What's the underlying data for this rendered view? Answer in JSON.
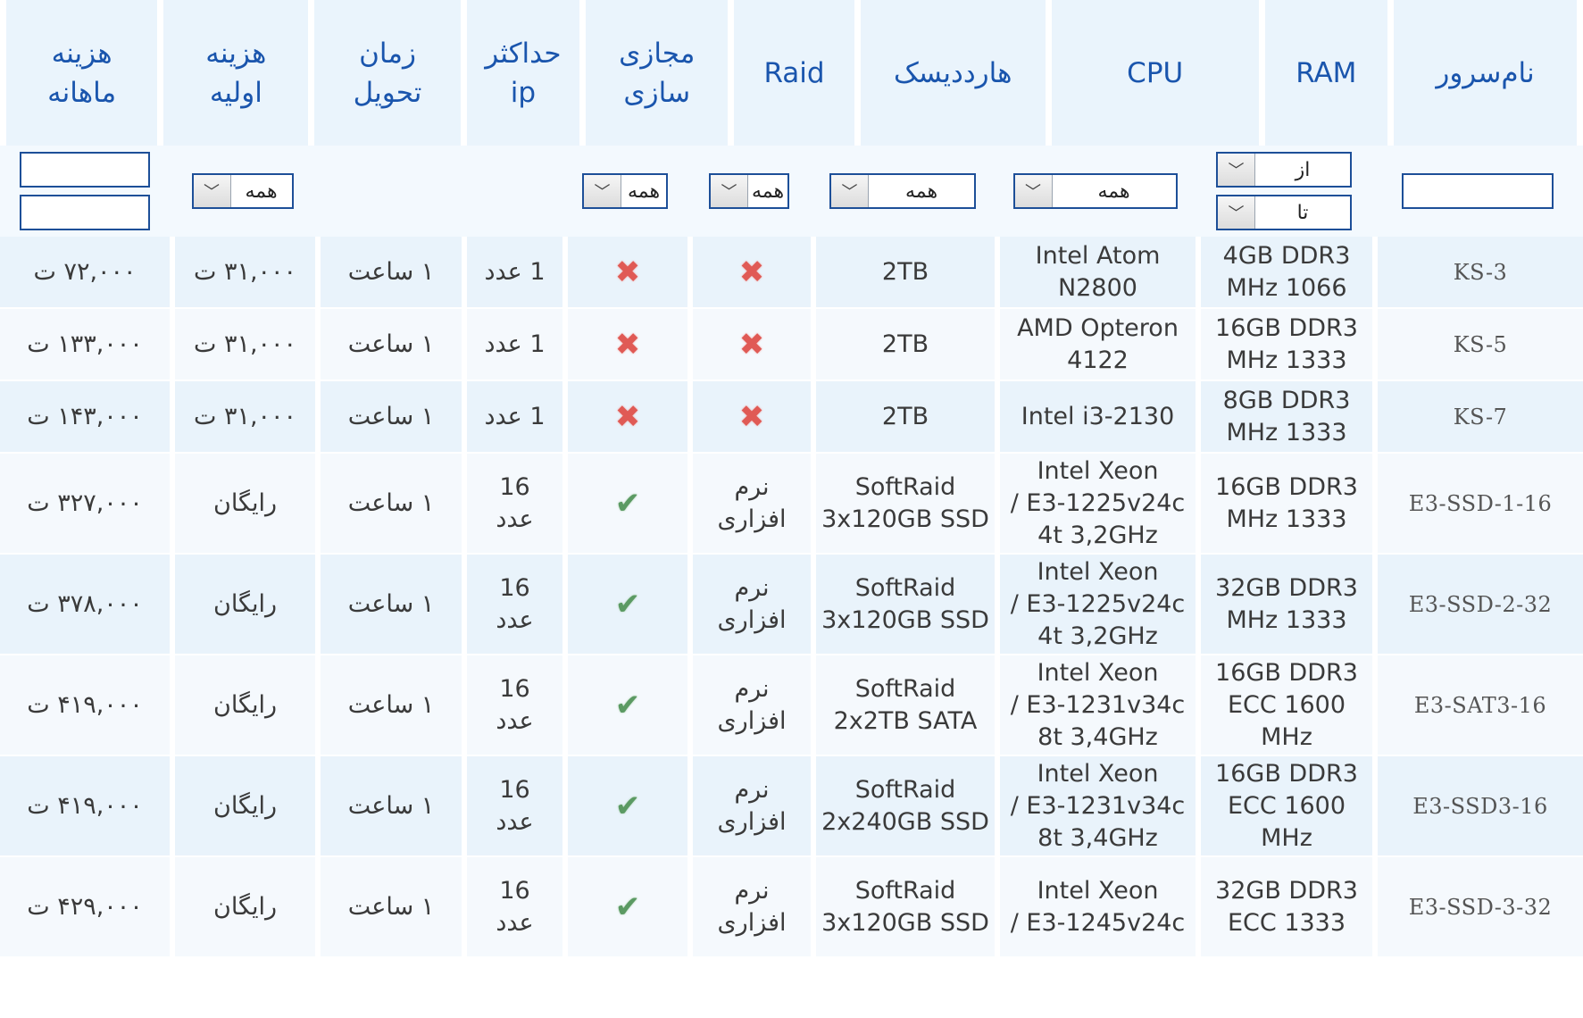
{
  "headers": {
    "name": "نام‌سرور",
    "ram": "RAM",
    "cpu": "CPU",
    "hdd": "هارددیسک",
    "raid": "Raid",
    "virt_1": "مجازی",
    "virt_2": "سازی",
    "ip_1": "حداکثر",
    "ip_2": "ip",
    "delivery_1": "زمان",
    "delivery_2": "تحویل",
    "setup_1": "هزینه",
    "setup_2": "اولیه",
    "monthly_1": "هزینه",
    "monthly_2": "ماهانه"
  },
  "filters": {
    "name_value": "",
    "ram_from": "از",
    "ram_to": "تا",
    "cpu": "همه",
    "hdd": "همه",
    "raid": "همه",
    "virt": "همه",
    "setup": "همه",
    "monthly_min": "",
    "monthly_max": ""
  },
  "icons": {
    "x": "✖",
    "check": "✔",
    "dropdown": "﹀"
  },
  "rows": [
    {
      "name": "KS-3",
      "ram": [
        "4GB DDR3",
        "1066 MHz"
      ],
      "cpu": [
        "Intel Atom",
        "N2800"
      ],
      "hdd": [
        "2TB"
      ],
      "raid": null,
      "virt": false,
      "ip": [
        "1 عدد"
      ],
      "delivery": "۱ ساعت",
      "setup": "۳۱,۰۰۰ ت",
      "monthly": "۷۲,۰۰۰ ت"
    },
    {
      "name": "KS-5",
      "ram": [
        "16GB DDR3",
        "1333 MHz"
      ],
      "cpu": [
        "AMD Opteron",
        "4122"
      ],
      "hdd": [
        "2TB"
      ],
      "raid": null,
      "virt": false,
      "ip": [
        "1 عدد"
      ],
      "delivery": "۱ ساعت",
      "setup": "۳۱,۰۰۰ ت",
      "monthly": "۱۳۳,۰۰۰ ت"
    },
    {
      "name": "KS-7",
      "ram": [
        "8GB DDR3",
        "1333 MHz"
      ],
      "cpu": [
        "Intel i3-2130"
      ],
      "hdd": [
        "2TB"
      ],
      "raid": null,
      "virt": false,
      "ip": [
        "1 عدد"
      ],
      "delivery": "۱ ساعت",
      "setup": "۳۱,۰۰۰ ت",
      "monthly": "۱۴۳,۰۰۰ ت"
    },
    {
      "name": "E3-SSD-1-16",
      "ram": [
        "16GB DDR3",
        "1333 MHz"
      ],
      "cpu": [
        "Intel Xeon",
        "E3-1225v24c /",
        "4t 3,2GHz"
      ],
      "hdd": [
        "SoftRaid",
        "3x120GB SSD"
      ],
      "raid": [
        "نرم",
        "افزاری"
      ],
      "virt": true,
      "ip": [
        "16",
        "عدد"
      ],
      "delivery": "۱ ساعت",
      "setup": "رایگان",
      "monthly": "۳۲۷,۰۰۰ ت"
    },
    {
      "name": "E3-SSD-2-32",
      "ram": [
        "32GB DDR3",
        "1333 MHz"
      ],
      "cpu": [
        "Intel Xeon",
        "E3-1225v24c /",
        "4t 3,2GHz"
      ],
      "hdd": [
        "SoftRaid",
        "3x120GB SSD"
      ],
      "raid": [
        "نرم",
        "افزاری"
      ],
      "virt": true,
      "ip": [
        "16",
        "عدد"
      ],
      "delivery": "۱ ساعت",
      "setup": "رایگان",
      "monthly": "۳۷۸,۰۰۰ ت"
    },
    {
      "name": "E3-SAT3-16",
      "ram": [
        "16GB DDR3",
        "ECC 1600",
        "MHz"
      ],
      "cpu": [
        "Intel Xeon",
        "E3-1231v34c /",
        "8t 3,4GHz"
      ],
      "hdd": [
        "SoftRaid",
        "2x2TB SATA"
      ],
      "raid": [
        "نرم",
        "افزاری"
      ],
      "virt": true,
      "ip": [
        "16",
        "عدد"
      ],
      "delivery": "۱ ساعت",
      "setup": "رایگان",
      "monthly": "۴۱۹,۰۰۰ ت"
    },
    {
      "name": "E3-SSD3-16",
      "ram": [
        "16GB DDR3",
        "ECC 1600",
        "MHz"
      ],
      "cpu": [
        "Intel Xeon",
        "E3-1231v34c /",
        "8t 3,4GHz"
      ],
      "hdd": [
        "SoftRaid",
        "2x240GB SSD"
      ],
      "raid": [
        "نرم",
        "افزاری"
      ],
      "virt": true,
      "ip": [
        "16",
        "عدد"
      ],
      "delivery": "۱ ساعت",
      "setup": "رایگان",
      "monthly": "۴۱۹,۰۰۰ ت"
    },
    {
      "name": "E3-SSD-3-32",
      "ram": [
        "32GB DDR3",
        "ECC 1333"
      ],
      "cpu": [
        "Intel Xeon",
        "E3-1245v24c /"
      ],
      "hdd": [
        "SoftRaid",
        "3x120GB SSD"
      ],
      "raid": [
        "نرم",
        "افزاری"
      ],
      "virt": true,
      "ip": [
        "16",
        "عدد"
      ],
      "delivery": "۱ ساعت",
      "setup": "رایگان",
      "monthly": "۴۲۹,۰۰۰ ت"
    }
  ]
}
